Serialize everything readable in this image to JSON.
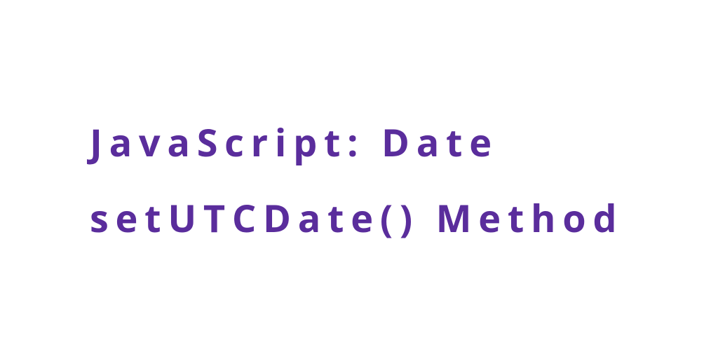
{
  "heading": {
    "text": "JavaScript: Date setUTCDate() Method"
  }
}
